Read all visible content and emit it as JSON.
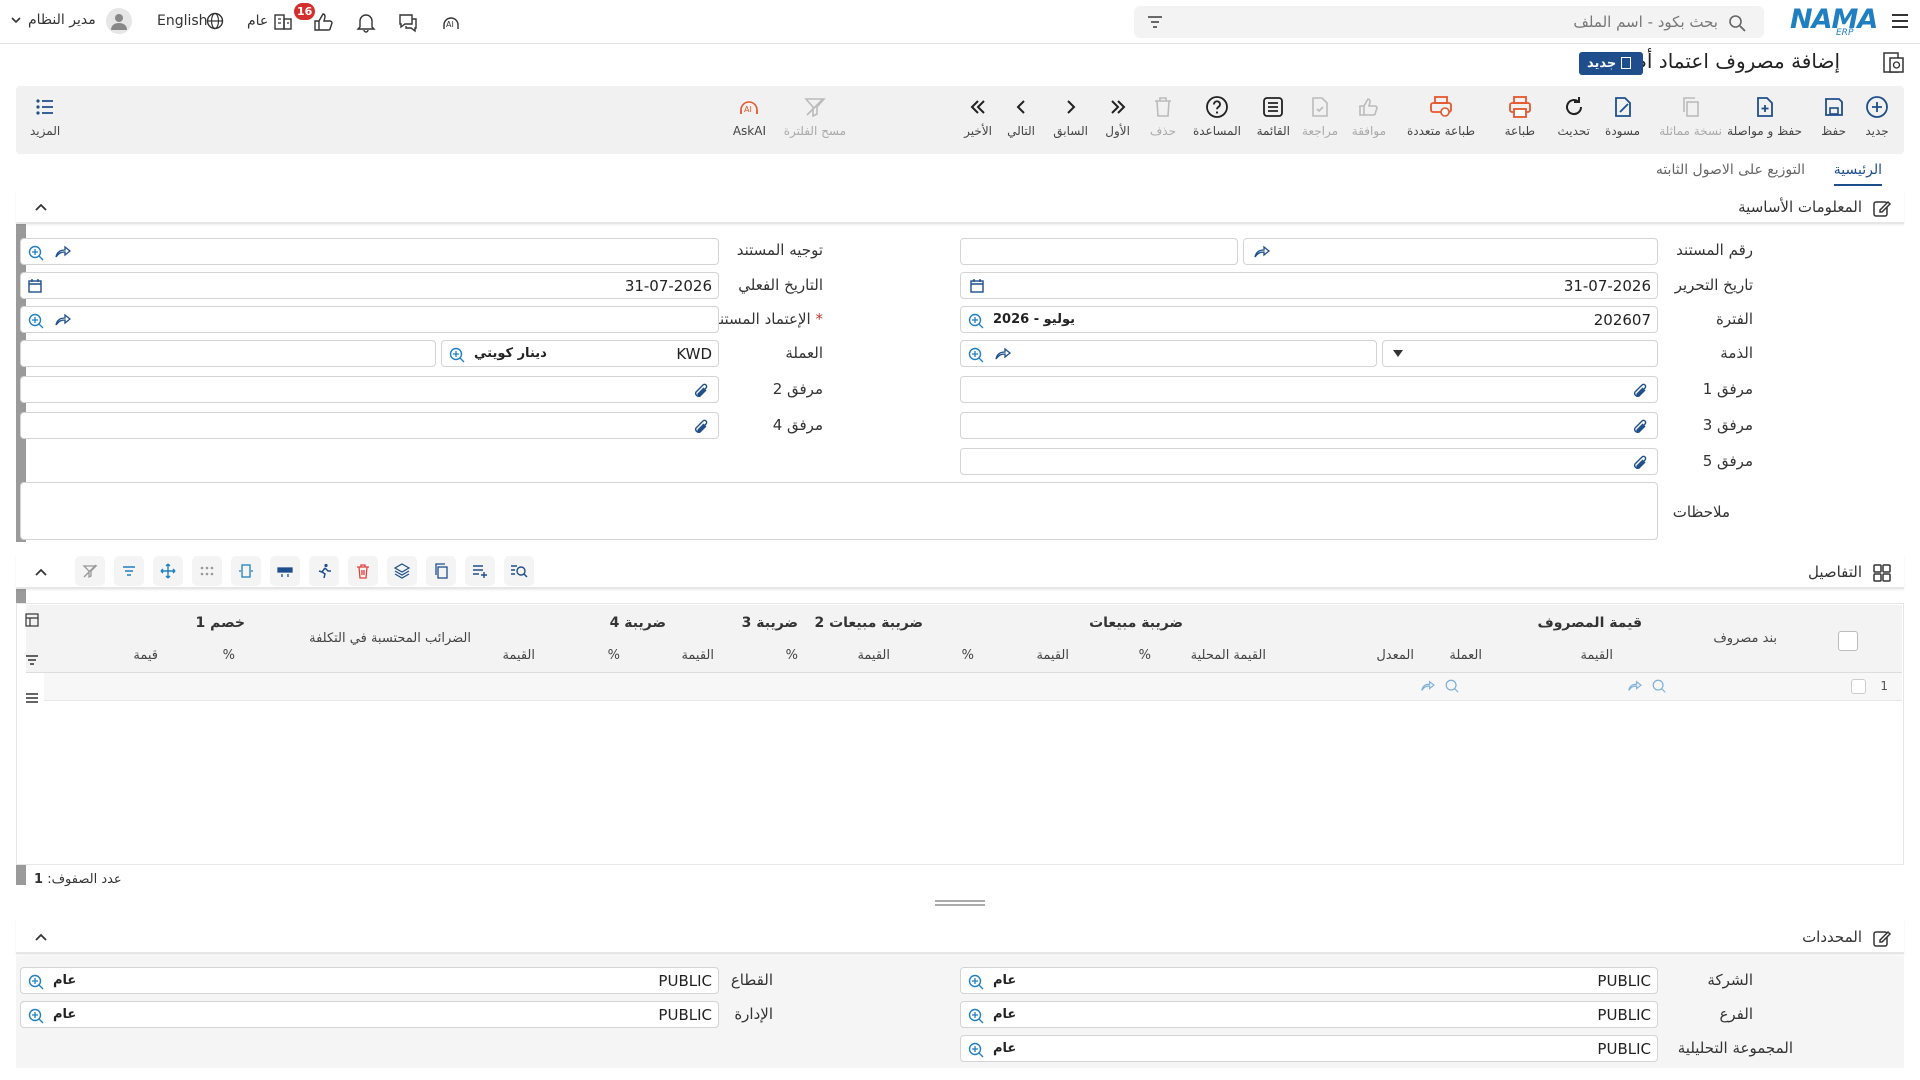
{
  "topbar": {
    "brand": "NAMA",
    "brand_sub": "ERP",
    "search_placeholder": "بحث بكود - اسم الملف",
    "user": "مدير النظام",
    "language": "English",
    "scope": "عام",
    "notif_count": "16"
  },
  "page": {
    "title": "إضافة مصروف اعتماد أصل",
    "badge": "جديد"
  },
  "toolbar": {
    "items": [
      "جديد",
      "حفظ",
      "حفظ و مواصلة",
      "نسخة مماثلة",
      "مسودة",
      "تحديث",
      "طباعة",
      "طباعة متعددة",
      "موافقة",
      "مراجعة",
      "القائمة",
      "المساعدة",
      "حذف",
      "الأول",
      "السابق",
      "التالي",
      "الأخير",
      "مسح الفلترة",
      "AskAI"
    ],
    "more": "المزيد"
  },
  "tabs": [
    "الرئيسية",
    "التوزيع على الاصول الثابته"
  ],
  "basic": {
    "title": "المعلومات الأساسية",
    "doc_no_label": "رقم المستند",
    "doc_route_label": "توجيه المستند",
    "edit_date_label": "تاريخ التحرير",
    "edit_date": "31-07-2026",
    "actual_date_label": "التاريخ الفعلي",
    "actual_date": "31-07-2026",
    "period_label": "الفترة",
    "period_code": "202607",
    "period_name": "2026 - يوليو",
    "doc_approval_label": "الإعتماد المستندي",
    "liability_label": "الذمة",
    "currency_label": "العملة",
    "currency_code": "KWD",
    "currency_name": "دينار كويتي",
    "att1": "مرفق 1",
    "att2": "مرفق 2",
    "att3": "مرفق 3",
    "att4": "مرفق 4",
    "att5": "مرفق 5",
    "notes_label": "ملاحظات"
  },
  "details": {
    "title": "التفاصيل",
    "groups": [
      "قيمة المصروف",
      "ضريبة مبيعات",
      "ضريبة مبيعات 2",
      "ضريبة 3",
      "ضريبة 4",
      "خصم 1"
    ],
    "cols": {
      "item": "بند مصروف",
      "value": "القيمة",
      "currency": "العملة",
      "rate": "المعدل",
      "local": "القيمة المحلية",
      "pct": "%",
      "cost_tax": "الضرائب المحتسبة في التكلفة",
      "amount": "قيمة"
    },
    "row_no": "1",
    "rows_count_label": "عدد الصفوف:",
    "rows_count": "1"
  },
  "dims": {
    "title": "المحددات",
    "company_label": "الشركة",
    "company_code": "PUBLIC",
    "company_name": "عام",
    "sector_label": "القطاع",
    "sector_code": "PUBLIC",
    "sector_name": "عام",
    "branch_label": "الفرع",
    "branch_code": "PUBLIC",
    "branch_name": "عام",
    "dept_label": "الإدارة",
    "dept_code": "PUBLIC",
    "dept_name": "عام",
    "analytic_label": "المجموعة التحليلية",
    "analytic_code": "PUBLIC",
    "analytic_name": "عام"
  },
  "colors": {
    "primary": "#1f4e8c",
    "accent_red": "#e4572e",
    "badge_red": "#d32f2f"
  }
}
